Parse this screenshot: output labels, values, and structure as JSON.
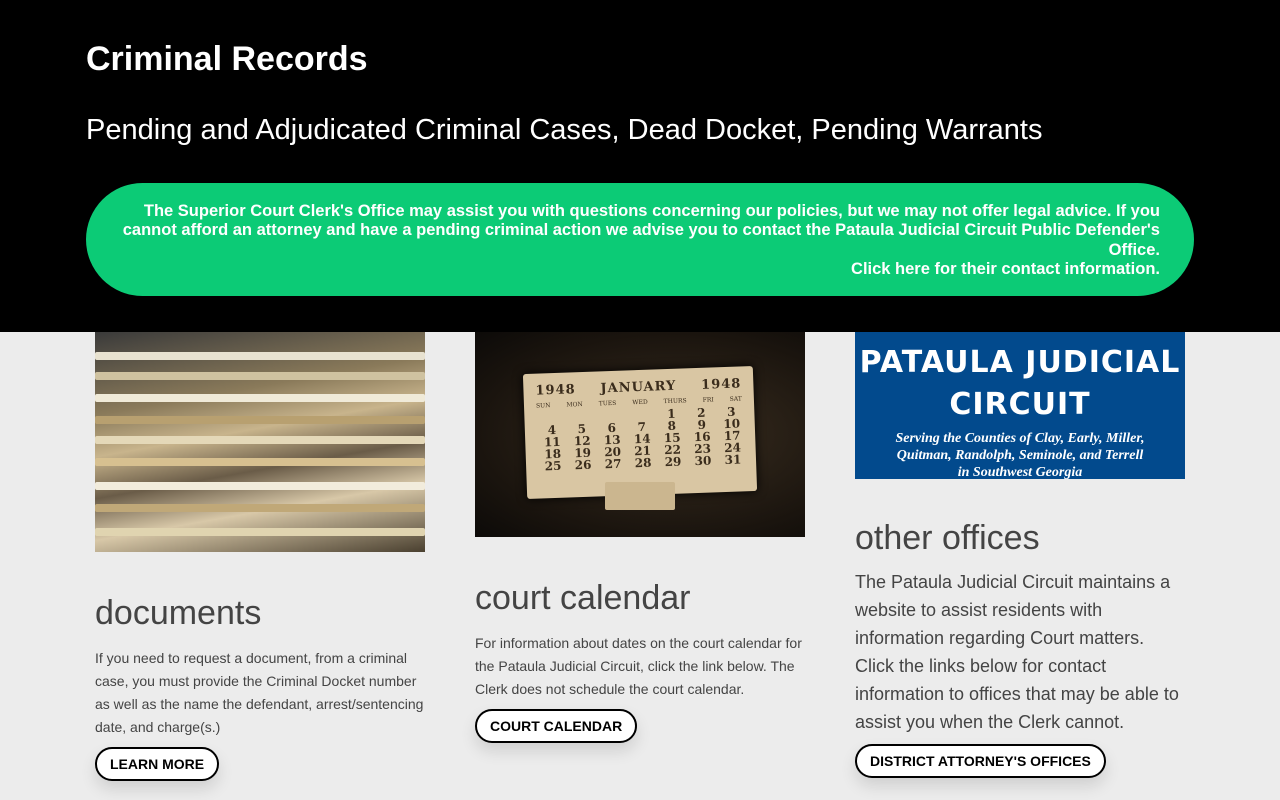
{
  "hero": {
    "title": "Criminal Records",
    "subtitle": "Pending and Adjudicated Criminal Cases, Dead Docket, Pending Warrants",
    "notice_text": "The Superior Court Clerk's Office may assist you with questions concerning our policies, but we may not offer legal advice. If you cannot afford an attorney and have a pending criminal action we advise you to contact the Pataula Judicial Circuit Public Defender's Office.",
    "notice_link": "Click here for their contact information.",
    "notice_color": "#0ccb76"
  },
  "columns": [
    {
      "heading": "documents",
      "image": "stacked-case-files-photo",
      "text": "If you need to request a document, from a criminal case, you must provide the Criminal Docket number as well as the name the defendant, arrest/sentencing date, and charge(s.)",
      "button": "LEARN MORE"
    },
    {
      "heading": "court calendar",
      "image": "1948-january-calendar-photo",
      "calendar": {
        "year_left": "1948",
        "month": "JANUARY",
        "year_right": "1948",
        "days": [
          "SUN",
          "MON",
          "TUES",
          "WED",
          "THURS",
          "FRI",
          "SAT"
        ],
        "rows": [
          [
            "",
            "",
            "",
            "",
            "1",
            "2",
            "3"
          ],
          [
            "4",
            "5",
            "6",
            "7",
            "8",
            "9",
            "10"
          ],
          [
            "11",
            "12",
            "13",
            "14",
            "15",
            "16",
            "17"
          ],
          [
            "18",
            "19",
            "20",
            "21",
            "22",
            "23",
            "24"
          ],
          [
            "25",
            "26",
            "27",
            "28",
            "29",
            "30",
            "31"
          ]
        ]
      },
      "text": "For information about dates on the court calendar for the Pataula Judicial Circuit, click the link below. The Clerk does not schedule the court calendar.",
      "button": "COURT CALENDAR"
    },
    {
      "heading": "other offices",
      "logo": {
        "line1": "PATAULA JUDICIAL",
        "line2": "CIRCUIT",
        "tagline1": "Serving the Counties of Clay, Early, Miller,",
        "tagline2": "Quitman, Randolph, Seminole, and Terrell",
        "tagline3": "in Southwest Georgia",
        "bg_color": "#024a8d"
      },
      "text": "The Pataula Judicial Circuit maintains a website to assist residents with information regarding Court matters. Click the links below for contact information to offices that may be able to assist you when the Clerk cannot.",
      "button": "DISTRICT ATTORNEY'S OFFICES"
    }
  ]
}
